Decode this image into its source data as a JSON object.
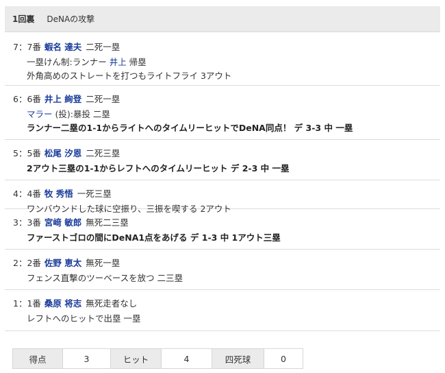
{
  "header": {
    "inning": "1回裏",
    "team": "DeNAの攻撃"
  },
  "plays": [
    {
      "seq": "7",
      "order": "7番",
      "batter": "蝦名 達夫",
      "situation": "二死一塁",
      "lines": [
        {
          "parts": [
            {
              "text": "一塁けん制:ランナー "
            },
            {
              "text": "井上",
              "link": true
            },
            {
              "text": " 帰塁"
            }
          ]
        },
        {
          "parts": [
            {
              "text": "外角高めのストレートを打つもライトフライ 3アウト"
            }
          ]
        }
      ]
    },
    {
      "seq": "6",
      "order": "6番",
      "batter": "井上 絢登",
      "situation": "二死一塁",
      "lines": [
        {
          "parts": [
            {
              "text": "マラー",
              "link": true
            },
            {
              "text": " (投):暴投 二塁"
            }
          ]
        },
        {
          "bold": true,
          "parts": [
            {
              "text": "ランナー二塁の1-1からライトへのタイムリーヒットでDeNA同点！ デ 3-3 中 一塁"
            }
          ]
        }
      ]
    },
    {
      "seq": "5",
      "order": "5番",
      "batter": "松尾 汐恩",
      "situation": "二死三塁",
      "lines": [
        {
          "bold": true,
          "parts": [
            {
              "text": "2アウト三塁の1-1からレフトへのタイムリーヒット デ 2-3 中 一塁"
            }
          ]
        }
      ]
    },
    {
      "seq": "4",
      "order": "4番",
      "batter": "牧 秀悟",
      "situation": "一死三塁",
      "lines": [
        {
          "parts": [
            {
              "text": "ワンバウンドした球に空振り、三振を喫する 2アウト"
            }
          ]
        }
      ]
    },
    {
      "seq": "3",
      "order": "3番",
      "batter": "宮﨑 敏郎",
      "situation": "無死二三塁",
      "lines": [
        {
          "bold": true,
          "parts": [
            {
              "text": "ファーストゴロの間にDeNA1点をあげる デ 1-3 中 1アウト三塁"
            }
          ]
        }
      ]
    },
    {
      "seq": "2",
      "order": "2番",
      "batter": "佐野 恵太",
      "situation": "無死一塁",
      "lines": [
        {
          "parts": [
            {
              "text": "フェンス直撃のツーベースを放つ 二三塁"
            }
          ]
        }
      ]
    },
    {
      "seq": "1",
      "order": "1番",
      "batter": "桑原 将志",
      "situation": "無死走者なし",
      "lines": [
        {
          "parts": [
            {
              "text": "レフトへのヒットで出塁 一塁"
            }
          ]
        }
      ]
    }
  ],
  "stats": [
    {
      "label": "得点",
      "value": "3"
    },
    {
      "label": "ヒット",
      "value": "4"
    },
    {
      "label": "四死球",
      "value": "0"
    }
  ]
}
